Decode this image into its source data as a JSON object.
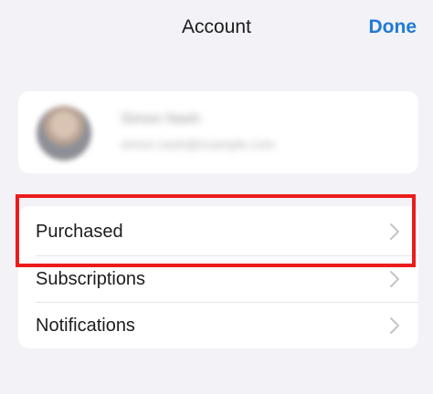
{
  "nav": {
    "title": "Account",
    "done_label": "Done"
  },
  "profile": {
    "name": "Simon Nash",
    "email": "simon.nash@example.com"
  },
  "menu": {
    "items": [
      {
        "label": "Purchased",
        "icon": "chevron-right-icon"
      },
      {
        "label": "Subscriptions",
        "icon": "chevron-right-icon"
      },
      {
        "label": "Notifications",
        "icon": "chevron-right-icon"
      }
    ]
  },
  "colors": {
    "accent": "#1f7ad6",
    "highlight": "#ec1c1c",
    "background": "#f2f2f7"
  }
}
